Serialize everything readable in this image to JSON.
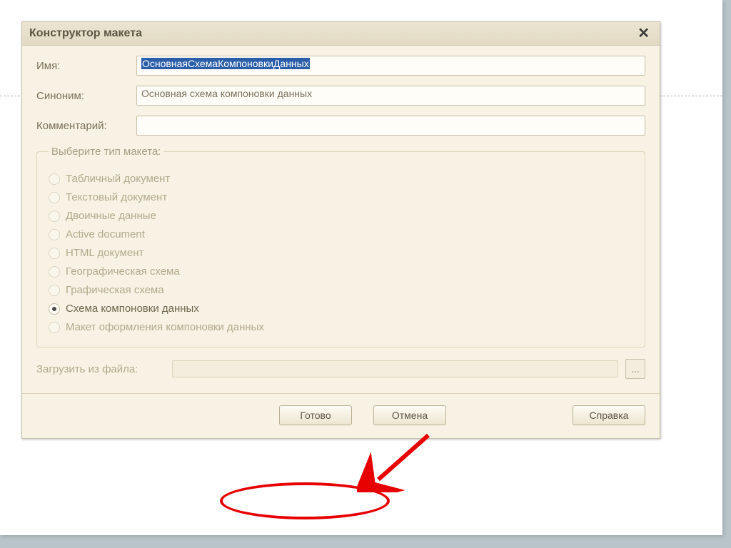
{
  "dialog": {
    "title": "Конструктор макета",
    "close_icon": "✕",
    "fields": {
      "name_label": "Имя:",
      "name_value": "ОсновнаяСхемаКомпоновкиДанных",
      "synonym_label": "Синоним:",
      "synonym_value": "Основная схема компоновки данных",
      "comment_label": "Комментарий:",
      "comment_value": ""
    },
    "typegroup": {
      "legend": "Выберите тип макета:",
      "options": [
        {
          "label": "Табличный документ",
          "selected": false,
          "enabled": false
        },
        {
          "label": "Текстовый документ",
          "selected": false,
          "enabled": false
        },
        {
          "label": "Двоичные данные",
          "selected": false,
          "enabled": false
        },
        {
          "label": "Active document",
          "selected": false,
          "enabled": false
        },
        {
          "label": "HTML документ",
          "selected": false,
          "enabled": false
        },
        {
          "label": "Географическая схема",
          "selected": false,
          "enabled": false
        },
        {
          "label": "Графическая схема",
          "selected": false,
          "enabled": false
        },
        {
          "label": "Схема компоновки данных",
          "selected": true,
          "enabled": true
        },
        {
          "label": "Макет оформления компоновки данных",
          "selected": false,
          "enabled": false
        }
      ]
    },
    "load": {
      "label": "Загрузить из файла:",
      "button": "..."
    },
    "buttons": {
      "done": "Готово",
      "cancel": "Отмена",
      "help": "Справка"
    }
  }
}
